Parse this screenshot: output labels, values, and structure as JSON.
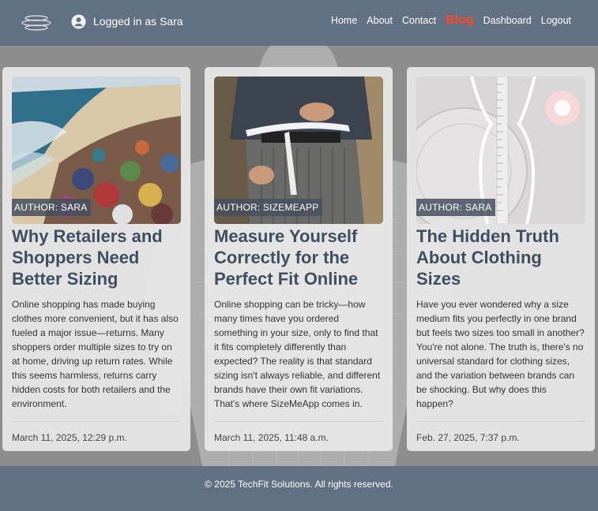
{
  "header": {
    "logged_in": "Logged in as Sara",
    "nav": [
      {
        "label": "Home"
      },
      {
        "label": "About"
      },
      {
        "label": "Contact"
      },
      {
        "label": "Blog"
      },
      {
        "label": "Dashboard"
      },
      {
        "label": "Logout"
      }
    ],
    "active": "Blog",
    "active_color": "#ff4a2a",
    "bar_color": "#627084"
  },
  "posts": [
    {
      "author": "AUTHOR: SARA",
      "title": "Why Retailers and Shoppers Need Better Sizing",
      "excerpt": "Online shopping has made buying clothes more convenient, but it has also fueled a major issue—returns. Many shoppers order multiple sizes to try on at home, driving up return rates. While this seems harmless, returns carry hidden costs for both retailers and the environment.",
      "date": "March 11, 2025, 12:29 p.m.",
      "image": "beach-clothing-waste-image"
    },
    {
      "author": "AUTHOR: SIZEMEAPP",
      "title": "Measure Yourself Correctly for the Perfect Fit Online",
      "excerpt": "Online shopping can be tricky—how many times have you ordered something in your size, only to find that it fits completely differently than expected? The reality is that standard sizing isn't always reliable, and different brands have their own fit variations. That's where SizeMeApp comes in.",
      "date": "March 11, 2025, 11:48 a.m.",
      "image": "waist-measuring-tape-image"
    },
    {
      "author": "AUTHOR: SARA",
      "title": "The Hidden Truth About Clothing Sizes",
      "excerpt": "Have you ever wondered why a size medium fits you perfectly in one brand but feels two sizes too small in another? You're not alone. The truth is, there's no universal standard for clothing sizes, and the variation between brands can be shocking. But why does this happen?",
      "date": "Feb. 27, 2025, 7:37 p.m.",
      "image": "body-outline-ruler-image"
    }
  ],
  "footer": {
    "text": "© 2025 TechFit Solutions. All rights reserved."
  }
}
